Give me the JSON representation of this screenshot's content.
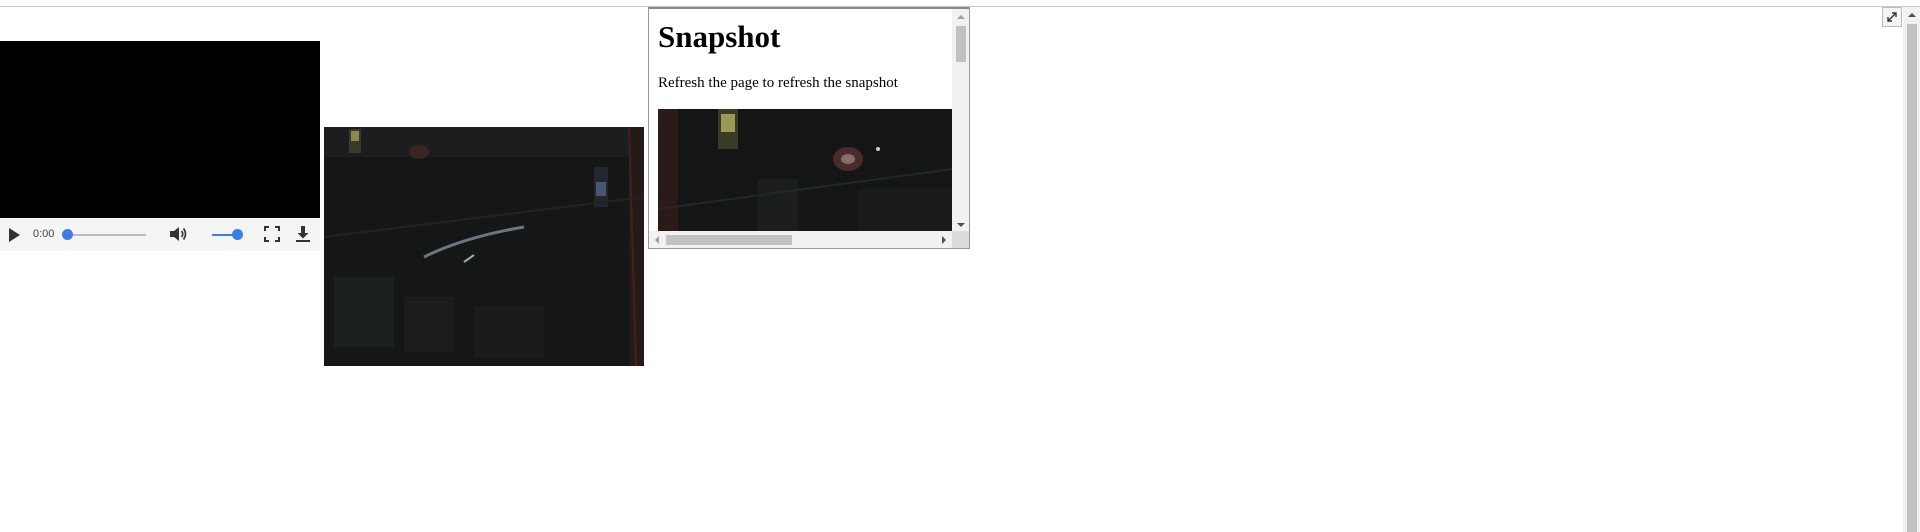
{
  "video_player": {
    "current_time": "0:00",
    "playback_progress": 0,
    "volume_level": 1.0
  },
  "snapshot": {
    "title": "Snapshot",
    "description": "Refresh the page to refresh the snapshot"
  },
  "colors": {
    "accent": "#3b7de9",
    "video_background": "#000000",
    "camera_dark": "#141716"
  },
  "icons": [
    "play-icon",
    "volume-icon",
    "fullscreen-icon",
    "download-icon",
    "expand-icon"
  ]
}
